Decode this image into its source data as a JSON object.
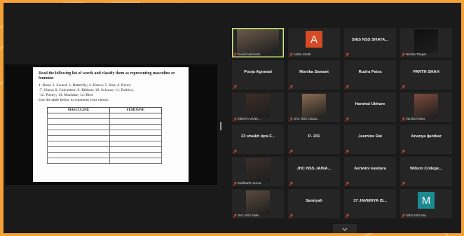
{
  "document": {
    "instruction": "Read the following list of words and classify them as representing masculine or feminine",
    "list_line1": "1. Rose; 2. Sword; 3. Butterfly; 4. Dance; 5. Iron; 6. River;",
    "list_line2": "-7. Chess; 8. Calculator; 9. Ribbon; 10. Science; 11. Politics;",
    "list_line3": "-12. Poetry; 13; Machine; 14. Bird",
    "list_line4": "Use the table below to represent your choice.",
    "table_headers": [
      "MASCULINE",
      "FEMININE"
    ]
  },
  "participants": [
    {
      "name": "",
      "tag": "Sunita Machado",
      "kind": "photo",
      "speaking": true
    },
    {
      "name": "",
      "tag": "Astha Sheth",
      "kind": "letter",
      "letter": "A",
      "color": "#d44a25"
    },
    {
      "name": "SIES NSS SHATA...",
      "tag": "",
      "kind": "text"
    },
    {
      "name": "",
      "tag": "Nishita Thapar",
      "kind": "photo"
    },
    {
      "name": "Pooja Agrawal",
      "tag": "",
      "kind": "text"
    },
    {
      "name": "Monika Sawant",
      "tag": "",
      "kind": "text"
    },
    {
      "name": "Rudra Patra",
      "tag": "",
      "kind": "text"
    },
    {
      "name": "PARTH SHAH",
      "tag": "",
      "kind": "text"
    },
    {
      "name": "",
      "tag": "MEERA VENK...",
      "kind": "photo"
    },
    {
      "name": "",
      "tag": "JHC NSS Gaura...",
      "kind": "photo"
    },
    {
      "name": "Harshal Ubhare",
      "tag": "",
      "kind": "text"
    },
    {
      "name": "",
      "tag": "Varsha Raina",
      "kind": "photo"
    },
    {
      "name": "23 shaikh Iqra F...",
      "tag": "",
      "kind": "text"
    },
    {
      "name": "P- 201",
      "tag": "",
      "kind": "text"
    },
    {
      "name": "Jasmine Rai",
      "tag": "",
      "kind": "text"
    },
    {
      "name": "Ananya Ijantkar",
      "tag": "",
      "kind": "text"
    },
    {
      "name": "",
      "tag": "Siddharth Verma",
      "kind": "photo"
    },
    {
      "name": "JHC NSS JAINA...",
      "tag": "",
      "kind": "text"
    },
    {
      "name": "Ashwini kawtara",
      "tag": "",
      "kind": "text"
    },
    {
      "name": "Wilson College...",
      "tag": "",
      "kind": "text"
    },
    {
      "name": "",
      "tag": "JHC NSS Saiki...",
      "kind": "photo"
    },
    {
      "name": "Samiyah",
      "tag": "",
      "kind": "text"
    },
    {
      "name": "37 JAVERIYA IS...",
      "tag": "",
      "kind": "text"
    },
    {
      "name": "",
      "tag": "SIES NSS Ma...",
      "kind": "letter",
      "letter": "M",
      "color": "#1c8a91"
    }
  ],
  "colors": {
    "background_orange": "#f4a236",
    "tile_bg": "#252525",
    "speaker_border": "#c8e67a",
    "mute_red": "#e0443a"
  },
  "icons": {
    "muted": "microphone-muted-icon",
    "more": "chevron-down-icon"
  }
}
